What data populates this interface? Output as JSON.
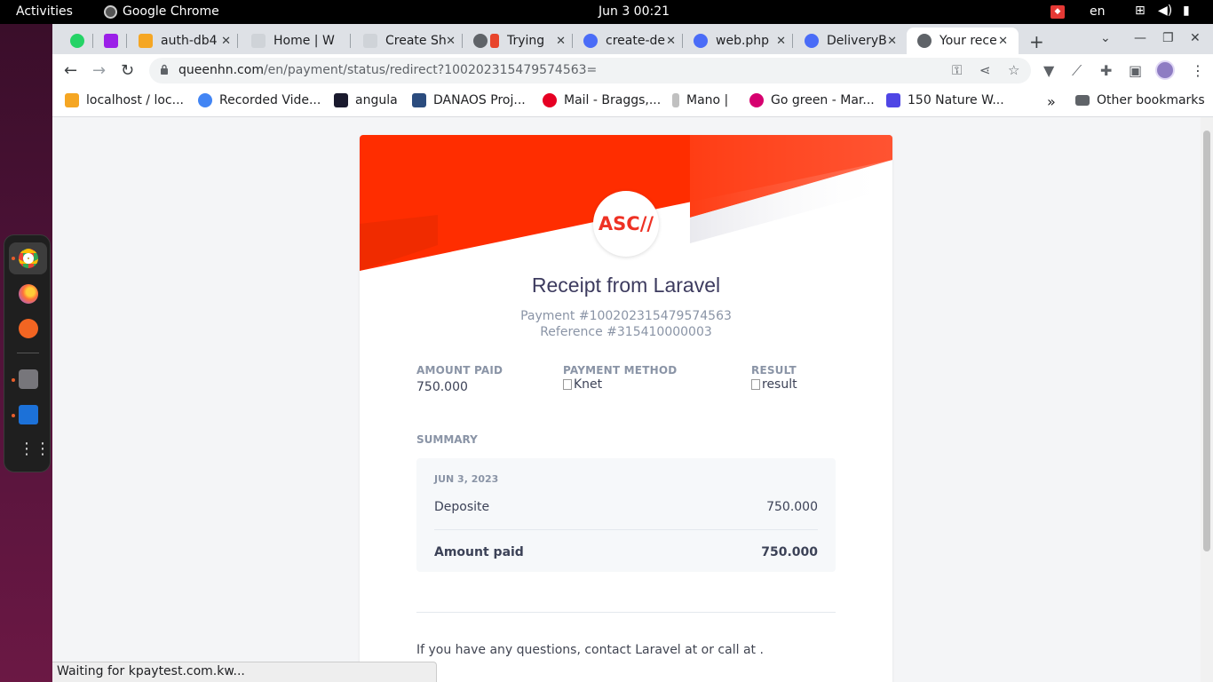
{
  "system": {
    "activities": "Activities",
    "app_name": "Google Chrome",
    "clock": "Jun 3  00:21",
    "lang": "en"
  },
  "tabs": [
    {
      "label": "",
      "color": "#25d366"
    },
    {
      "label": "",
      "color": "#9b1fe8"
    },
    {
      "label": "auth-db4",
      "color": "#f5a623"
    },
    {
      "label": "Home | W",
      "color": "#5f6368"
    },
    {
      "label": "Create Sh",
      "color": "#5f6368"
    },
    {
      "label": "Trying",
      "color": "#5f6368"
    },
    {
      "label": "create-de",
      "color": "#4a6cf7"
    },
    {
      "label": "web.php",
      "color": "#4a6cf7"
    },
    {
      "label": "DeliveryB",
      "color": "#4a6cf7"
    },
    {
      "label": "Your rece",
      "color": "#5f6368"
    }
  ],
  "address_bar": {
    "host": "queenhn.com",
    "path": "/en/payment/status/redirect?100202315479574563="
  },
  "bookmarks": [
    {
      "label": "localhost / loc...",
      "color": "#f5a623"
    },
    {
      "label": "Recorded Vide...",
      "color": "#4285f4"
    },
    {
      "label": "angula",
      "color": "#1a1a2e"
    },
    {
      "label": "DANAOS Proj...",
      "color": "#2b4c7e"
    },
    {
      "label": "Mail - Braggs,...",
      "color": "#e60023"
    },
    {
      "label": "Mano |",
      "color": "#888888"
    },
    {
      "label": "Go green - Mar...",
      "color": "#d6006f"
    },
    {
      "label": "150 Nature W...",
      "color": "#4f46e5"
    }
  ],
  "other_bookmarks": "Other bookmarks",
  "receipt": {
    "logo_text": "ASC//",
    "title": "Receipt from Laravel",
    "payment": "Payment #100202315479574563",
    "reference": "Reference #315410000003",
    "amount_paid_label": "AMOUNT PAID",
    "amount_paid_value": "750.000",
    "payment_method_label": "PAYMENT METHOD",
    "payment_method_alt": "Knet",
    "result_label": "RESULT",
    "result_alt": "result",
    "summary_label": "SUMMARY",
    "summary_date": "JUN 3, 2023",
    "line_item_label": "Deposite",
    "line_item_value": "750.000",
    "total_label": "Amount paid",
    "total_value": "750.000",
    "contact": "If you have any questions, contact Laravel at or call at ."
  },
  "status_bubble": "Waiting for kpaytest.com.kw...",
  "colors": {
    "hero_red": "#ff2d00",
    "accent": "#ee3124"
  }
}
